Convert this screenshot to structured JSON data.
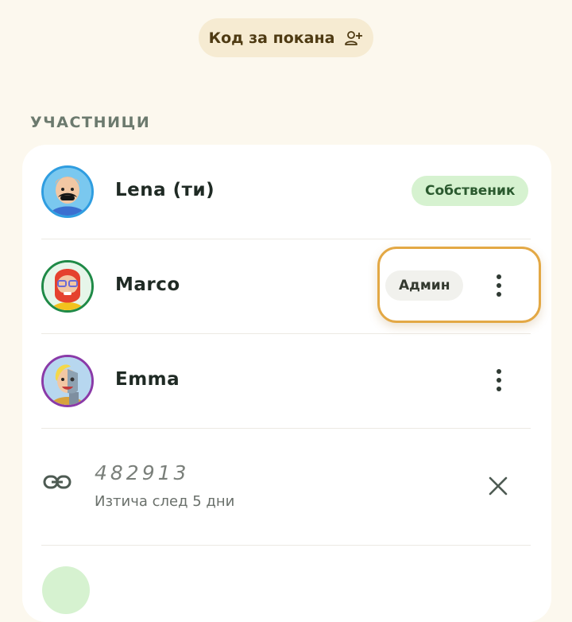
{
  "invite": {
    "label": "Код за покана",
    "icon": "person-add-icon"
  },
  "section": {
    "title": "УЧАСТНИЦИ"
  },
  "members": [
    {
      "name": "Lena (ти)",
      "role": "Собственик",
      "ring": "#2f9de0"
    },
    {
      "name": "Marco",
      "role": "Админ",
      "ring": "#1f8a47"
    },
    {
      "name": "Emma",
      "ring": "#8a3aa8"
    }
  ],
  "invite_code": {
    "code": "482913",
    "expires": "Изтича след 5 дни"
  },
  "colors": {
    "background": "#fcf8ee",
    "owner_badge": "#d6f2d0",
    "highlight": "#e3a845"
  }
}
